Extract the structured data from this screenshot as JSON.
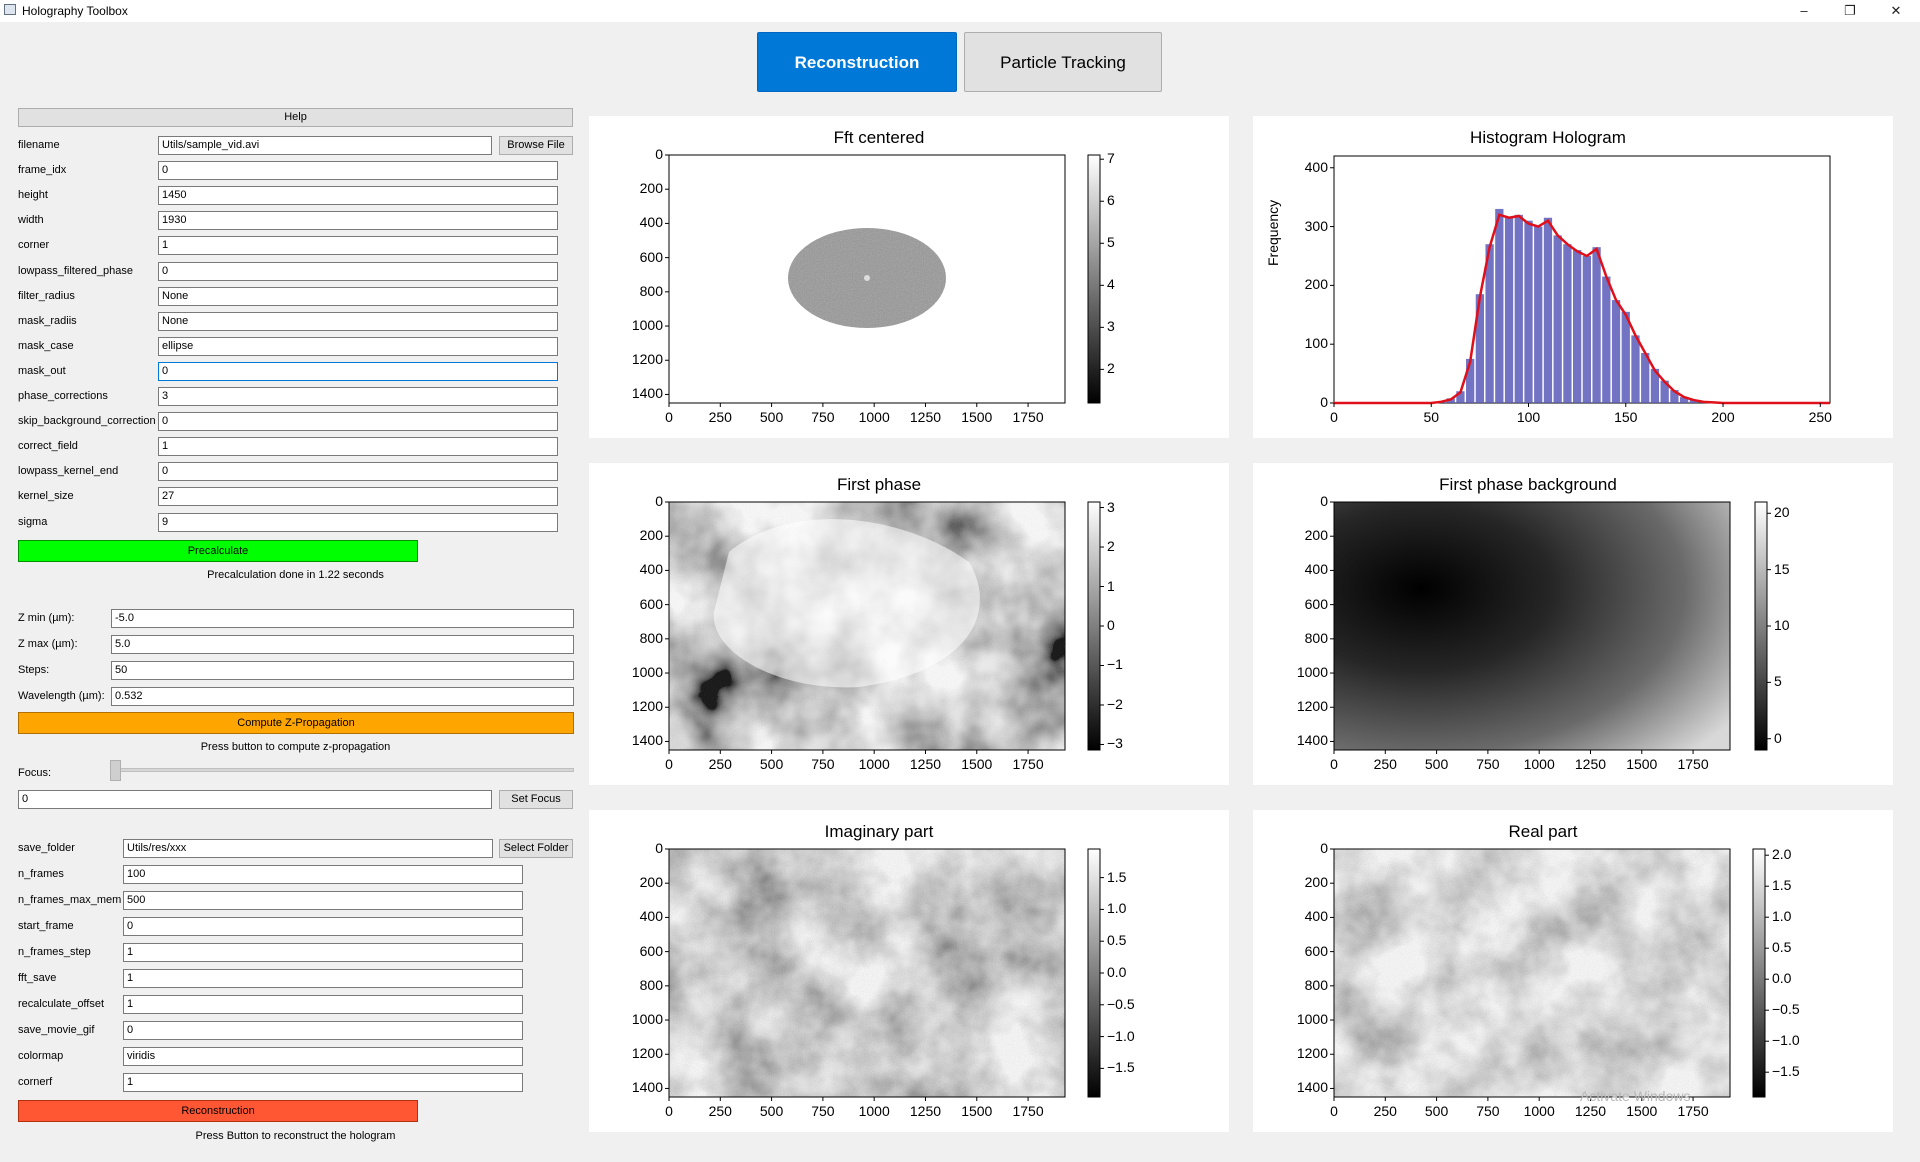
{
  "window": {
    "title": "Holography Toolbox",
    "min_glyph": "–",
    "max_glyph": "❐",
    "close_glyph": "✕"
  },
  "tabs": [
    {
      "label": "Reconstruction",
      "active": true
    },
    {
      "label": "Particle Tracking",
      "active": false
    }
  ],
  "help_button": "Help",
  "params": [
    {
      "label": "filename",
      "value": "Utils/sample_vid.avi"
    },
    {
      "label": "frame_idx",
      "value": "0"
    },
    {
      "label": "height",
      "value": "1450"
    },
    {
      "label": "width",
      "value": "1930"
    },
    {
      "label": "corner",
      "value": "1"
    },
    {
      "label": "lowpass_filtered_phase",
      "value": "0"
    },
    {
      "label": "filter_radius",
      "value": "None"
    },
    {
      "label": "mask_radiis",
      "value": "None"
    },
    {
      "label": "mask_case",
      "value": "ellipse"
    },
    {
      "label": "mask_out",
      "value": "0"
    },
    {
      "label": "phase_corrections",
      "value": "3"
    },
    {
      "label": "skip_background_correction",
      "value": "0"
    },
    {
      "label": "correct_field",
      "value": "1"
    },
    {
      "label": "lowpass_kernel_end",
      "value": "0"
    },
    {
      "label": "kernel_size",
      "value": "27"
    },
    {
      "label": "sigma",
      "value": "9"
    }
  ],
  "browse_button": "Browse File",
  "precalculate_button": "Precalculate",
  "precalc_status": "Precalculation done in 1.22 seconds",
  "zprop": [
    {
      "label": "Z min (µm):",
      "value": "-5.0"
    },
    {
      "label": "Z max (µm):",
      "value": "5.0"
    },
    {
      "label": "Steps:",
      "value": "50"
    },
    {
      "label": "Wavelength (µm):",
      "value": "0.532"
    }
  ],
  "compute_button": "Compute Z-Propagation",
  "compute_status": "Press button to compute z-propagation",
  "focus": {
    "label": "Focus:",
    "slider_level": 0,
    "value": "0",
    "button": "Set Focus"
  },
  "save": [
    {
      "label": "save_folder",
      "value": "Utils/res/xxx"
    },
    {
      "label": "n_frames",
      "value": "100"
    },
    {
      "label": "n_frames_max_mem",
      "value": "500"
    },
    {
      "label": "start_frame",
      "value": "0"
    },
    {
      "label": "n_frames_step",
      "value": "1"
    },
    {
      "label": "fft_save",
      "value": "1"
    },
    {
      "label": "recalculate_offset",
      "value": "1"
    },
    {
      "label": "save_movie_gif",
      "value": "0"
    },
    {
      "label": "colormap",
      "value": "viridis"
    },
    {
      "label": "cornerf",
      "value": "1"
    }
  ],
  "select_folder_button": "Select Folder",
  "reconstruction_button": "Reconstruction",
  "recon_status": "Press Button to reconstruct the hologram",
  "colors": {
    "precalculate": "#00ff00",
    "compute": "#ffa500",
    "reconstruction": "#ff5733",
    "accent": "#0078d7",
    "histogram_bars": "#5b5bb8",
    "histogram_curve": "#e0101a"
  },
  "watermark": "Activate Windows",
  "chart_data": [
    {
      "type": "image",
      "title": "Fft centered",
      "colormap": "gray",
      "xticks": [
        "0",
        "250",
        "500",
        "750",
        "1000",
        "1250",
        "1500",
        "1750"
      ],
      "yticks": [
        "0",
        "200",
        "400",
        "600",
        "800",
        "1000",
        "1200",
        "1400"
      ],
      "cbar_ticks": [
        "7",
        "6",
        "5",
        "4",
        "3",
        "2"
      ],
      "xlim": [
        0,
        1930
      ],
      "ylim": [
        1450,
        0
      ],
      "clim": [
        1.2,
        7.1
      ],
      "content": "elliptical mask centered"
    },
    {
      "type": "bar",
      "title": "Histogram Hologram",
      "ylabel": "Frequency",
      "xticks": [
        "0",
        "50",
        "100",
        "150",
        "200",
        "250"
      ],
      "yticks": [
        "0",
        "100",
        "200",
        "300",
        "400"
      ],
      "xlim": [
        0,
        255
      ],
      "ylim": [
        0,
        420
      ],
      "x": [
        50,
        55,
        60,
        65,
        70,
        75,
        80,
        85,
        90,
        95,
        100,
        105,
        110,
        115,
        120,
        125,
        130,
        135,
        140,
        145,
        150,
        155,
        160,
        165,
        170,
        175,
        180,
        185,
        190,
        195,
        200
      ],
      "values": [
        0,
        2,
        8,
        20,
        75,
        185,
        270,
        330,
        315,
        320,
        310,
        300,
        315,
        285,
        270,
        260,
        250,
        265,
        215,
        175,
        155,
        115,
        85,
        58,
        38,
        22,
        10,
        5,
        2,
        1,
        0
      ],
      "curve": [
        0,
        2,
        6,
        18,
        70,
        180,
        265,
        320,
        315,
        318,
        305,
        300,
        310,
        285,
        270,
        258,
        250,
        262,
        215,
        175,
        150,
        115,
        85,
        55,
        36,
        20,
        10,
        5,
        2,
        1,
        0
      ]
    },
    {
      "type": "image",
      "title": "First phase",
      "colormap": "gray",
      "xticks": [
        "0",
        "250",
        "500",
        "750",
        "1000",
        "1250",
        "1500",
        "1750"
      ],
      "yticks": [
        "0",
        "200",
        "400",
        "600",
        "800",
        "1000",
        "1200",
        "1400"
      ],
      "cbar_ticks": [
        "3",
        "2",
        "1",
        "0",
        "−1",
        "−2",
        "−3"
      ],
      "clim": [
        -3.14,
        3.14
      ]
    },
    {
      "type": "image",
      "title": "First phase background",
      "colormap": "gray",
      "xticks": [
        "0",
        "250",
        "500",
        "750",
        "1000",
        "1250",
        "1500",
        "1750"
      ],
      "yticks": [
        "0",
        "200",
        "400",
        "600",
        "800",
        "1000",
        "1200",
        "1400"
      ],
      "cbar_ticks": [
        "20",
        "15",
        "10",
        "5",
        "0"
      ],
      "clim": [
        -1,
        21
      ]
    },
    {
      "type": "image",
      "title": "Imaginary part",
      "colormap": "gray",
      "xticks": [
        "0",
        "250",
        "500",
        "750",
        "1000",
        "1250",
        "1500",
        "1750"
      ],
      "yticks": [
        "0",
        "200",
        "400",
        "600",
        "800",
        "1000",
        "1200",
        "1400"
      ],
      "cbar_ticks": [
        "1.5",
        "1.0",
        "0.5",
        "0.0",
        "−0.5",
        "−1.0",
        "−1.5"
      ],
      "clim": [
        -1.95,
        1.95
      ]
    },
    {
      "type": "image",
      "title": "Real part",
      "colormap": "gray",
      "xticks": [
        "0",
        "250",
        "500",
        "750",
        "1000",
        "1250",
        "1500",
        "1750"
      ],
      "yticks": [
        "0",
        "200",
        "400",
        "600",
        "800",
        "1000",
        "1200",
        "1400"
      ],
      "cbar_ticks": [
        "2.0",
        "1.5",
        "1.0",
        "0.5",
        "0.0",
        "−0.5",
        "−1.0",
        "−1.5"
      ],
      "clim": [
        -1.9,
        2.1
      ]
    }
  ]
}
